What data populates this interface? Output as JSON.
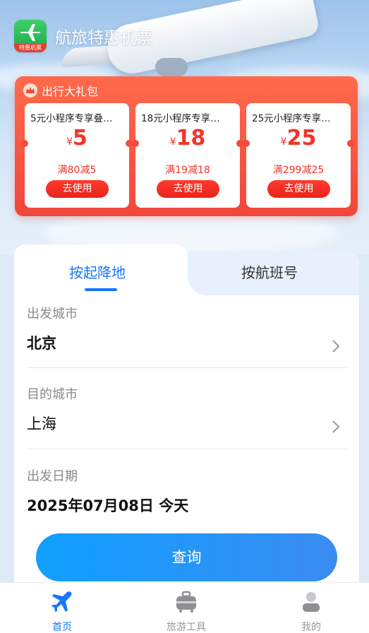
{
  "header": {
    "app_title": "航旅特惠机票",
    "logo_text": "特惠机票"
  },
  "gift_pack": {
    "title": "出行大礼包",
    "coupons": [
      {
        "name": "5元小程序专享叠…",
        "currency": "¥",
        "amount": "5",
        "condition": "满80减5",
        "button": "去使用"
      },
      {
        "name": "18元小程序专享…",
        "currency": "¥",
        "amount": "18",
        "condition": "满19减18",
        "button": "去使用"
      },
      {
        "name": "25元小程序专享…",
        "currency": "¥",
        "amount": "25",
        "condition": "满299减25",
        "button": "去使用"
      }
    ]
  },
  "search_tabs": [
    {
      "label": "按起降地",
      "active": true
    },
    {
      "label": "按航班号",
      "active": false
    }
  ],
  "form": {
    "departure": {
      "label": "出发城市",
      "value": "北京"
    },
    "arrival": {
      "label": "目的城市",
      "value": "上海"
    },
    "date": {
      "label": "出发日期",
      "value": "2025年07月08日 今天"
    },
    "search_button": "查询"
  },
  "tabbar": [
    {
      "label": "首页",
      "icon": "airplane-icon",
      "active": true
    },
    {
      "label": "旅游工具",
      "icon": "luggage-icon",
      "active": false
    },
    {
      "label": "我的",
      "icon": "user-icon",
      "active": false
    }
  ],
  "colors": {
    "primary": "#1677ff",
    "coupon_red": "#f2352a",
    "gift_bg": "#f1463a"
  }
}
